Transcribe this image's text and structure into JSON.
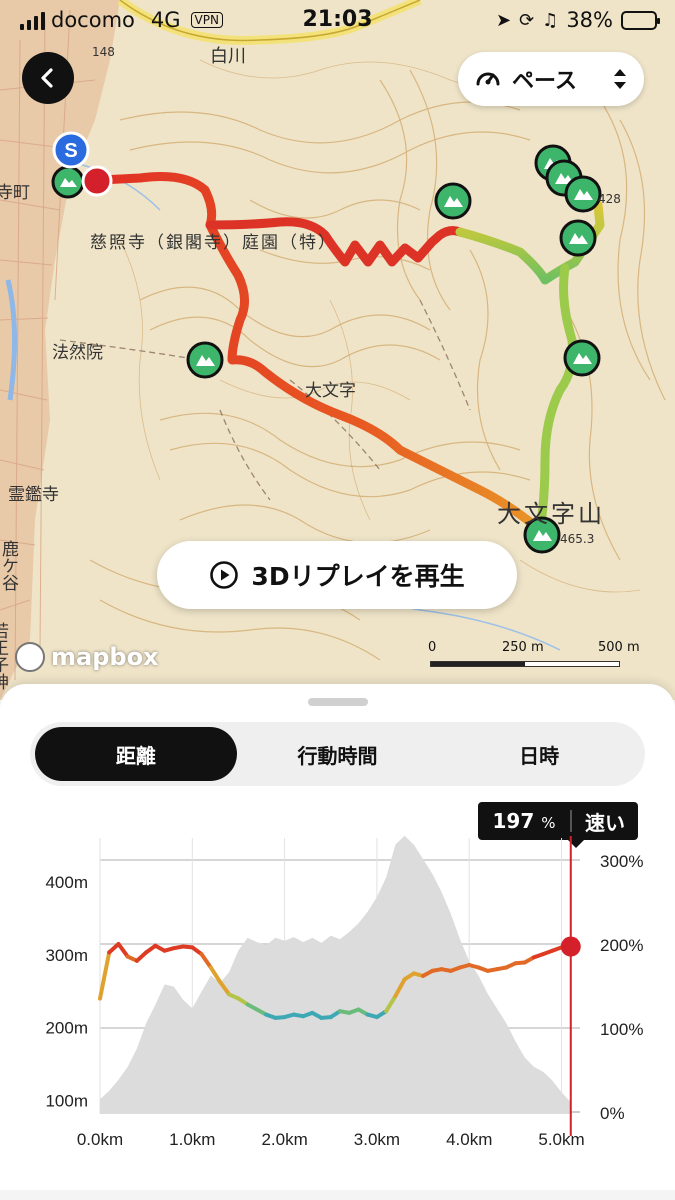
{
  "status_bar": {
    "carrier": "docomo",
    "network": "4G",
    "vpn": "VPN",
    "time": "21:03",
    "battery": "38%",
    "battery_level": 0.38
  },
  "map": {
    "pace_label": "ペース",
    "replay_label": "3Dリプレイを再生",
    "attribution": "mapbox",
    "scale": {
      "zero": "0",
      "mid": "250 m",
      "max": "500 m"
    },
    "start_marker": "S",
    "labels": [
      {
        "text": "白川"
      },
      {
        "text": "慈照寺（銀閣寺）庭園（特）"
      },
      {
        "text": "法然院"
      },
      {
        "text": "大文字"
      },
      {
        "text": "大文字山"
      },
      {
        "text": "霊鑑寺"
      },
      {
        "text": "鹿ケ谷"
      },
      {
        "text": "若王子神"
      },
      {
        "text": "寺町"
      },
      {
        "text": "465.3"
      },
      {
        "text": "428"
      },
      {
        "text": "148"
      }
    ]
  },
  "sheet": {
    "tabs": [
      {
        "label": "距離",
        "active": true
      },
      {
        "label": "行動時間",
        "active": false
      },
      {
        "label": "日時",
        "active": false
      }
    ],
    "tooltip": {
      "value": "197",
      "unit": "%",
      "speed": "速い"
    }
  },
  "chart_data": {
    "type": "area",
    "x_unit": "km",
    "x_ticks": [
      "0.0km",
      "1.0km",
      "2.0km",
      "3.0km",
      "4.0km",
      "5.0km"
    ],
    "y_left_ticks": [
      "100m",
      "200m",
      "300m",
      "400m"
    ],
    "y_right_ticks": [
      "0%",
      "100%",
      "200%",
      "300%"
    ],
    "xlim": [
      0,
      5.2
    ],
    "ylim_left": [
      80,
      470
    ],
    "ylim_right": [
      0,
      300
    ],
    "grid": true,
    "cursor_x": 5.1,
    "cursor_pace": 197,
    "series": [
      {
        "type": "area",
        "x": [
          0,
          0.1,
          0.2,
          0.3,
          0.4,
          0.5,
          0.6,
          0.7,
          0.8,
          0.9,
          1.0,
          1.1,
          1.2,
          1.3,
          1.4,
          1.5,
          1.6,
          1.7,
          1.8,
          1.9,
          2.0,
          2.1,
          2.2,
          2.3,
          2.4,
          2.5,
          2.6,
          2.7,
          2.8,
          2.9,
          3.0,
          3.1,
          3.2,
          3.3,
          3.4,
          3.5,
          3.6,
          3.7,
          3.8,
          3.9,
          4.0,
          4.1,
          4.2,
          4.3,
          4.4,
          4.5,
          4.6,
          4.7,
          4.8,
          4.9,
          5.0,
          5.1
        ],
        "values": [
          100,
          112,
          127,
          145,
          170,
          205,
          230,
          258,
          255,
          237,
          225,
          248,
          270,
          260,
          275,
          305,
          322,
          316,
          312,
          322,
          318,
          323,
          316,
          322,
          315,
          325,
          320,
          330,
          342,
          358,
          378,
          405,
          450,
          462,
          450,
          430,
          410,
          385,
          355,
          320,
          290,
          270,
          245,
          225,
          205,
          180,
          158,
          145,
          138,
          126,
          110,
          96
        ]
      },
      {
        "type": "line",
        "x": [
          0,
          0.1,
          0.2,
          0.3,
          0.4,
          0.5,
          0.6,
          0.7,
          0.8,
          0.9,
          1.0,
          1.1,
          1.2,
          1.3,
          1.4,
          1.5,
          1.6,
          1.7,
          1.8,
          1.9,
          2.0,
          2.1,
          2.2,
          2.3,
          2.4,
          2.5,
          2.6,
          2.7,
          2.8,
          2.9,
          3.0,
          3.1,
          3.2,
          3.3,
          3.4,
          3.5,
          3.6,
          3.7,
          3.8,
          3.9,
          4.0,
          4.1,
          4.2,
          4.3,
          4.4,
          4.5,
          4.6,
          4.7,
          4.8,
          4.9,
          5.0,
          5.1
        ],
        "values": [
          135,
          190,
          200,
          185,
          180,
          190,
          198,
          192,
          195,
          197,
          196,
          188,
          172,
          155,
          140,
          135,
          128,
          122,
          116,
          112,
          113,
          116,
          114,
          118,
          112,
          113,
          120,
          118,
          122,
          116,
          113,
          120,
          138,
          158,
          165,
          162,
          168,
          170,
          168,
          172,
          175,
          172,
          168,
          170,
          172,
          177,
          178,
          184,
          188,
          192,
          196,
          197
        ]
      }
    ]
  }
}
